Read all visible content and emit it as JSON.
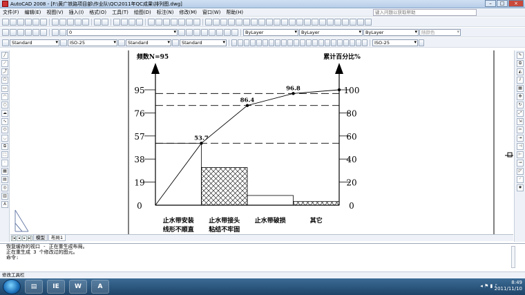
{
  "window": {
    "title": "AutoCAD 2008 - [F:\\黄广铁路项目部\\作业队\\QC\\2011年QC成果\\排列图.dwg]",
    "buttons": [
      "–",
      "□",
      "×"
    ]
  },
  "menu": {
    "items": [
      "文件(F)",
      "编辑(E)",
      "视图(V)",
      "插入(I)",
      "格式(O)",
      "工具(T)",
      "绘图(D)",
      "标注(N)",
      "修改(M)",
      "窗口(W)",
      "帮助(H)"
    ],
    "help_placeholder": "键入问题以获取帮助"
  },
  "toolbars": {
    "layer": "0",
    "color": "ByLayer",
    "linetype": "ByLayer",
    "lineweight": "ByLayer",
    "plotstyle": "随颜色",
    "text_style": "Standard",
    "dim_style": "ISO-25",
    "table_style": "Standard",
    "mleader_style": "Standard",
    "dim_style2": "ISO-25"
  },
  "chart_data": {
    "type": "pareto",
    "left_axis_label": "频数N=95",
    "right_axis_label": "累计百分比%",
    "left_ticks": [
      "0",
      "19",
      "38",
      "57",
      "76",
      "95"
    ],
    "right_ticks": [
      "0",
      "20",
      "40",
      "60",
      "80",
      "100"
    ],
    "ylim_left": [
      0,
      95
    ],
    "ylim_right": [
      0,
      100
    ],
    "categories": [
      "止水带安装线形不顺直",
      "止水带接头粘结不牢固",
      "止水带破损",
      "其它"
    ],
    "category_lines": [
      [
        "止水带安装",
        "线形不顺直"
      ],
      [
        "止水带接头",
        "粘结不牢固"
      ],
      [
        "止水带破损"
      ],
      [
        "其它"
      ]
    ],
    "bar_values": [
      51,
      31,
      8,
      3
    ],
    "bar_fills": [
      "none",
      "crosshatch",
      "none",
      "crosshatch"
    ],
    "cumulative_percent": [
      0,
      53.7,
      86.4,
      96.8,
      100
    ],
    "cumulative_labels": [
      "53.7",
      "86.4",
      "96.8"
    ],
    "dashed_lines_percent": [
      53.7,
      86.4,
      96.8
    ]
  },
  "tabs": {
    "items": [
      "模型",
      "布局1"
    ],
    "active": "模型"
  },
  "command": {
    "history": [
      "恢复缓存的视口 - 正在重生成布局。",
      "正在重生成 3 个修改过的图元。"
    ],
    "prompt": "命令:"
  },
  "status": {
    "text": "修改工具栏"
  },
  "taskbar": {
    "time": "8:49",
    "date": "2011/11/10",
    "apps": [
      "IE",
      "W",
      "A"
    ]
  }
}
